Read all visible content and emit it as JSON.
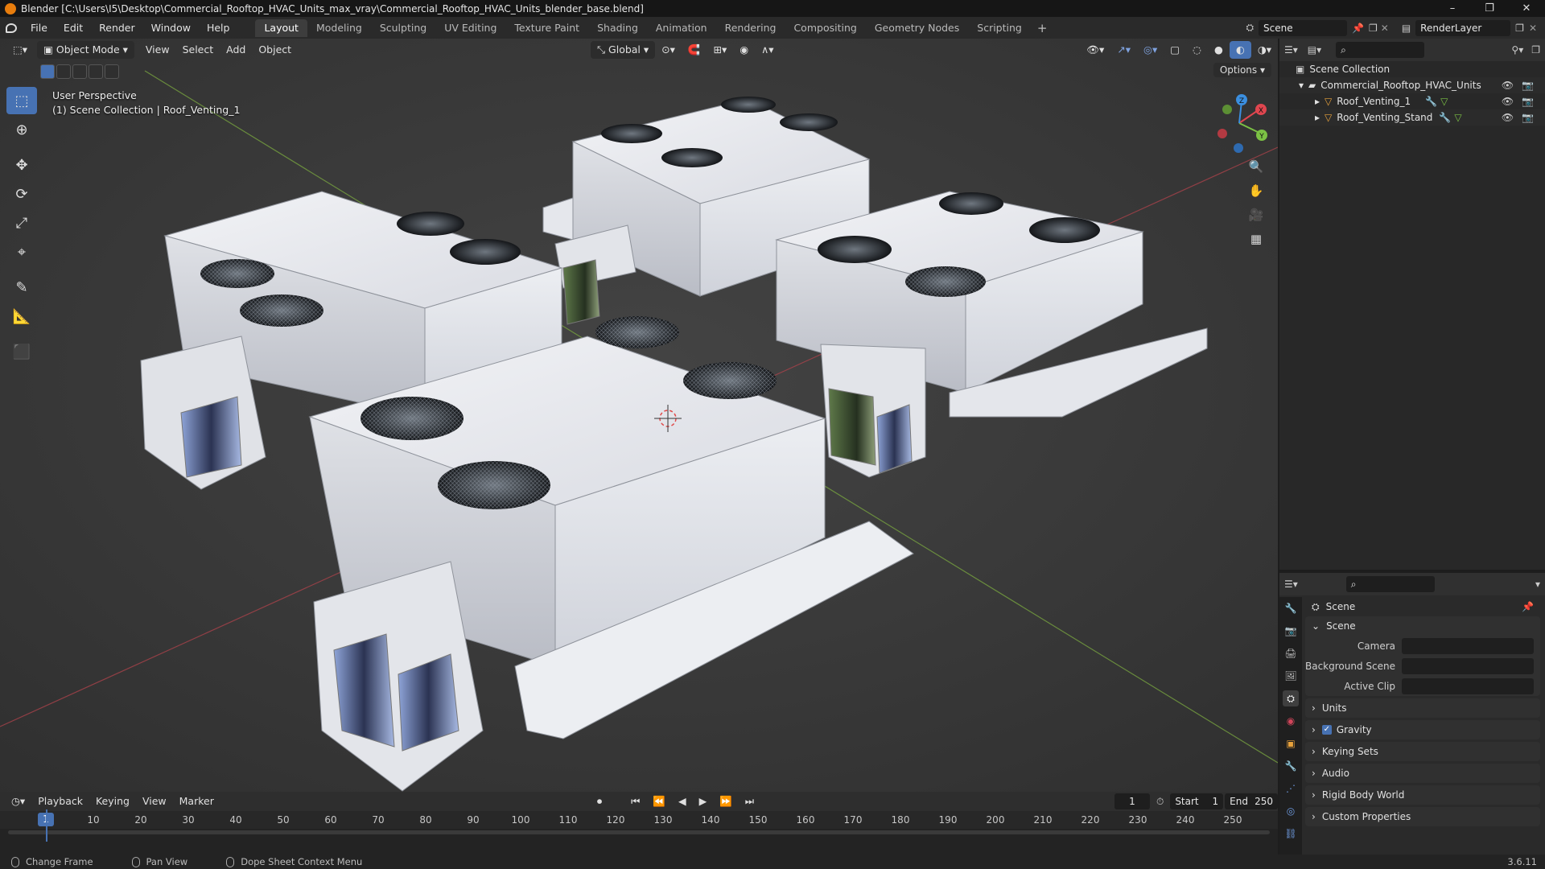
{
  "window": {
    "title": "Blender [C:\\Users\\I5\\Desktop\\Commercial_Rooftop_HVAC_Units_max_vray\\Commercial_Rooftop_HVAC_Units_blender_base.blend]",
    "minimize": "–",
    "maximize": "❐",
    "close": "✕"
  },
  "menu": [
    "File",
    "Edit",
    "Render",
    "Window",
    "Help"
  ],
  "workspaces": [
    "Layout",
    "Modeling",
    "Sculpting",
    "UV Editing",
    "Texture Paint",
    "Shading",
    "Animation",
    "Rendering",
    "Compositing",
    "Geometry Nodes",
    "Scripting"
  ],
  "workspace_add": "+",
  "scene_field": "Scene",
  "render_layer_field": "RenderLayer",
  "viewport": {
    "mode": "Object Mode",
    "menus": [
      "View",
      "Select",
      "Add",
      "Object"
    ],
    "transform_orientation": "Global",
    "options": "Options",
    "perspective": "User Perspective",
    "collection_info": "(1) Scene Collection | Roof_Venting_1",
    "gizmo": {
      "x": "X",
      "y": "Y",
      "z": "Z"
    }
  },
  "outliner": {
    "root": "Scene Collection",
    "collection": "Commercial_Rooftop_HVAC_Units",
    "objects": [
      "Roof_Venting_1",
      "Roof_Venting_Stand"
    ]
  },
  "properties": {
    "header": "Scene",
    "scene_panel": "Scene",
    "fields": [
      {
        "label": "Camera"
      },
      {
        "label": "Background Scene"
      },
      {
        "label": "Active Clip"
      }
    ],
    "panels": [
      "Units",
      "Gravity",
      "Keying Sets",
      "Audio",
      "Rigid Body World",
      "Custom Properties"
    ],
    "gravity_checked": true
  },
  "timeline": {
    "menus": [
      "Playback",
      "Keying",
      "View",
      "Marker"
    ],
    "current_frame": "1",
    "start_label": "Start",
    "start": "1",
    "end_label": "End",
    "end": "250",
    "ruler": [
      "1",
      "10",
      "20",
      "30",
      "40",
      "50",
      "60",
      "70",
      "80",
      "90",
      "100",
      "110",
      "120",
      "130",
      "140",
      "150",
      "160",
      "170",
      "180",
      "190",
      "200",
      "210",
      "220",
      "230",
      "240",
      "250"
    ]
  },
  "statusbar": {
    "items": [
      "Change Frame",
      "Pan View",
      "Dope Sheet Context Menu"
    ],
    "version": "3.6.11"
  },
  "colors": {
    "accent": "#4772b3",
    "axis_x": "#e0464f",
    "axis_y": "#7bc144",
    "axis_z": "#3b8fe0",
    "object_orange": "#e8a23c"
  }
}
